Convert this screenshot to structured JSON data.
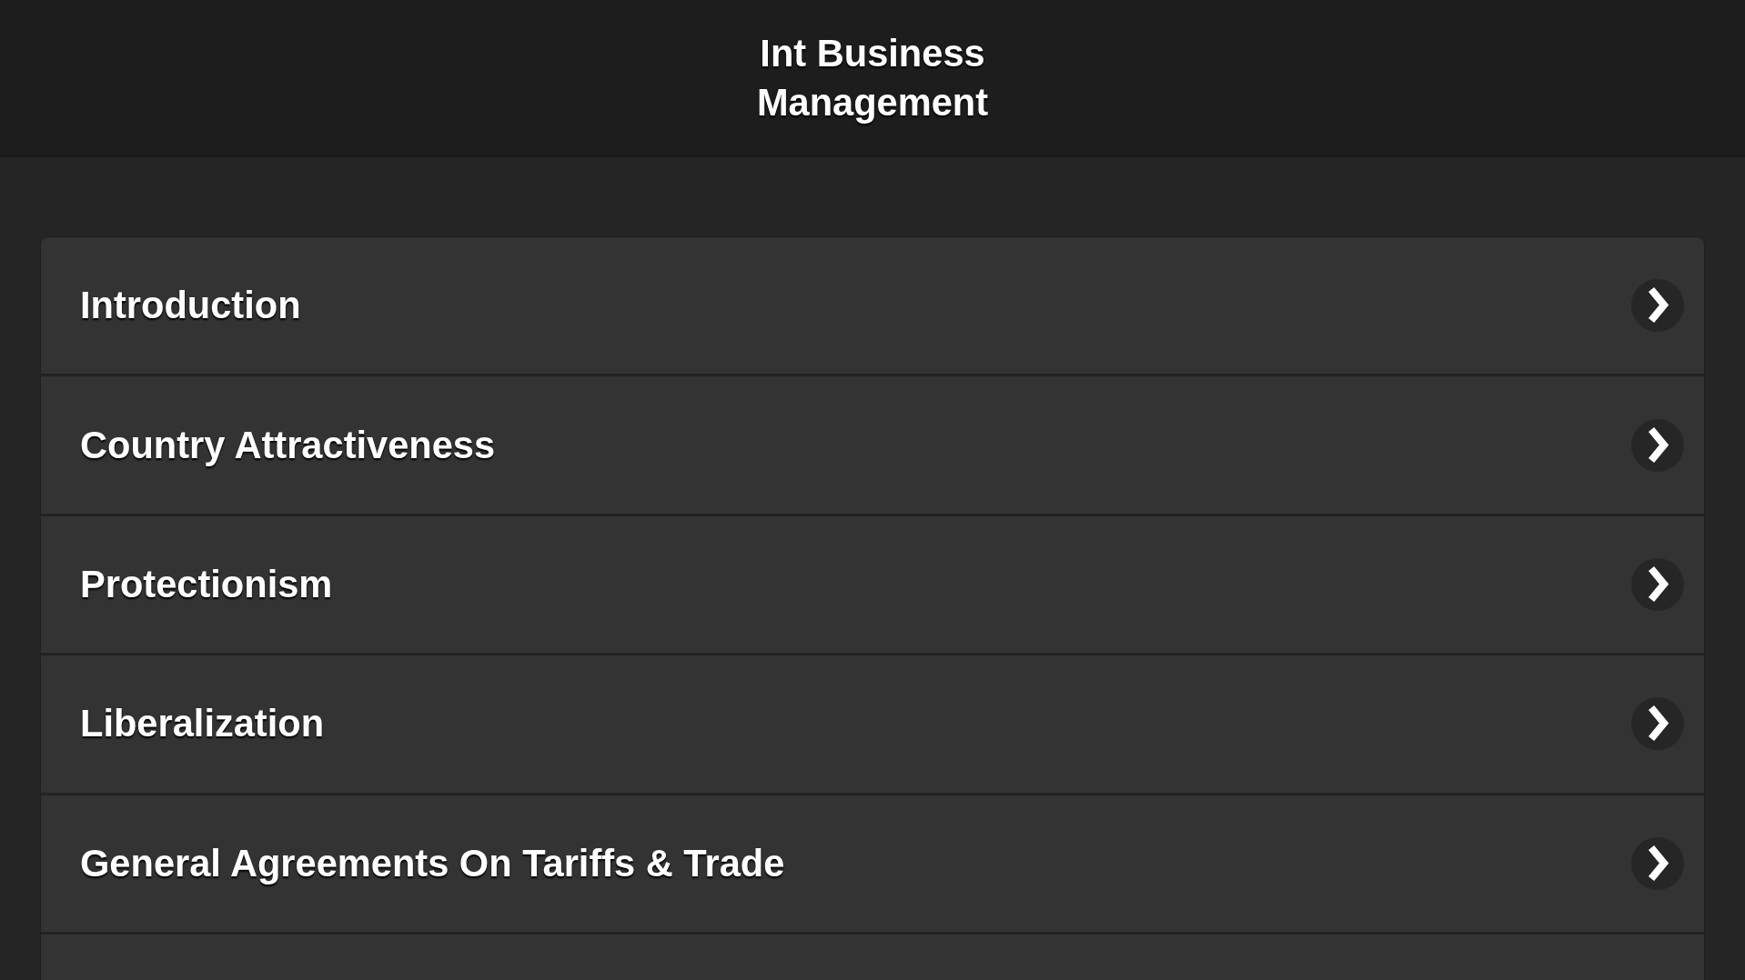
{
  "header": {
    "title": "Int Business Management"
  },
  "menu": {
    "items": [
      {
        "label": "Introduction"
      },
      {
        "label": "Country Attractiveness"
      },
      {
        "label": "Protectionism"
      },
      {
        "label": "Liberalization"
      },
      {
        "label": "General Agreements On Tariffs & Trade"
      }
    ]
  }
}
